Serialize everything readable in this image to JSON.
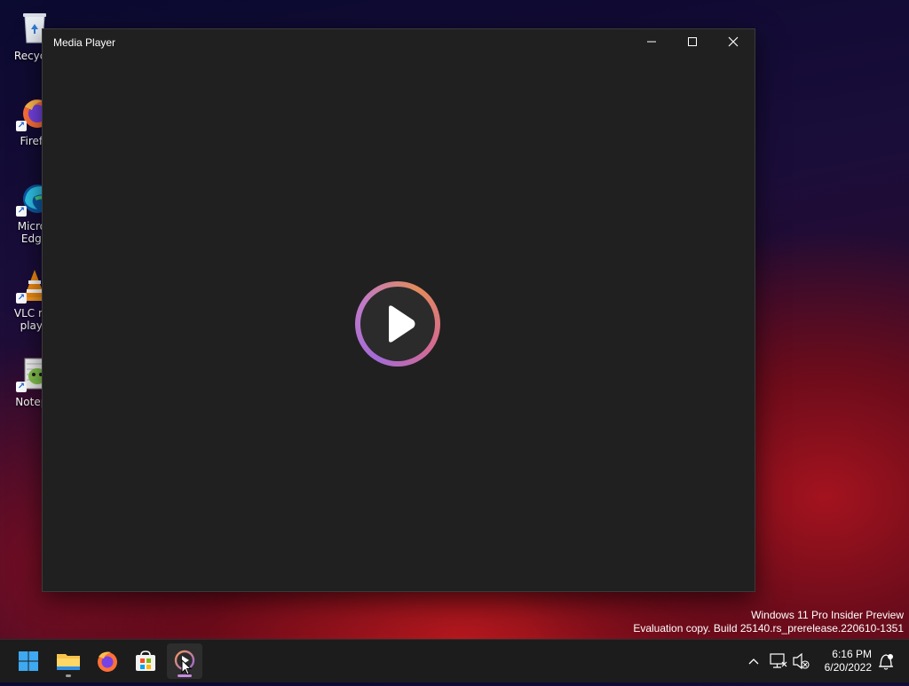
{
  "desktop": {
    "icons": [
      {
        "label": "Recycle",
        "icon": "recycle-bin-icon"
      },
      {
        "label": "Firefo",
        "icon": "firefox-icon"
      },
      {
        "label": "Micros\nEdge",
        "label_lines": [
          "Micros",
          "Edge"
        ],
        "icon": "edge-icon"
      },
      {
        "label_lines": [
          "VLC me",
          "playe"
        ],
        "icon": "vlc-icon"
      },
      {
        "label": "Notepa",
        "icon": "notepad-plus-plus-icon"
      }
    ]
  },
  "window": {
    "title": "Media Player",
    "controls": {
      "minimize": "minimize-icon",
      "maximize": "maximize-icon",
      "close": "close-icon"
    },
    "play_icon": "play-icon"
  },
  "watermark": {
    "line1": "Windows 11 Pro Insider Preview",
    "line2": "Evaluation copy. Build 25140.rs_prerelease.220610-1351"
  },
  "taskbar": {
    "items": [
      {
        "name": "start",
        "icon": "windows-start-icon",
        "active": false
      },
      {
        "name": "file-explorer",
        "icon": "folder-icon",
        "active": false,
        "running": true
      },
      {
        "name": "firefox",
        "icon": "firefox-icon",
        "active": false
      },
      {
        "name": "microsoft-store",
        "icon": "store-icon",
        "active": false
      },
      {
        "name": "media-player",
        "icon": "media-player-icon",
        "active": true,
        "running": true
      }
    ],
    "tray": {
      "chevron": "chevron-up-icon",
      "network": "network-icon",
      "volume": "volume-muted-icon",
      "time": "6:16 PM",
      "date": "6/20/2022",
      "notification": "notification-icon"
    }
  },
  "colors": {
    "window_bg": "#202020",
    "taskbar_bg": "#1c1c1c",
    "accent": "#c58be0"
  }
}
